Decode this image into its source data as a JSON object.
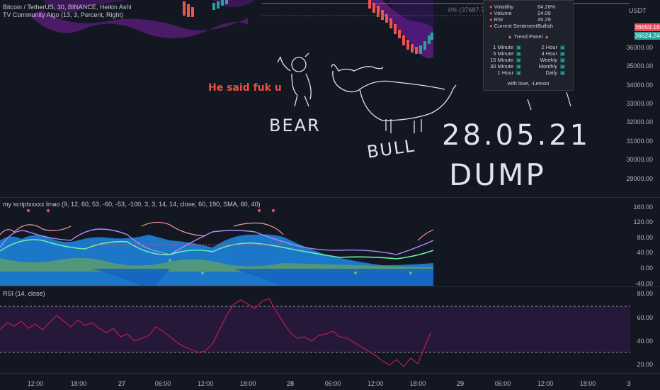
{
  "header": {
    "symbol_line": "Bitcoin / TetherUS, 30, BINANCE, Heikin Ashi",
    "indicator_line": "TV Community Algo (13, 3, Percent, Right)",
    "currency": "USDT"
  },
  "main": {
    "percent_label": "0% (37687.77)",
    "price_axis": [
      "35000.00",
      "34000.00",
      "33000.00",
      "32000.00",
      "31000.00",
      "30000.00",
      "29000.00",
      "36000.00"
    ],
    "price_tags": [
      {
        "text": "36659.16",
        "color": "#e84a5f"
      },
      {
        "text": "36624.24",
        "color": "#26a69a"
      }
    ],
    "annotation_text": "He said fuk u",
    "drawings": {
      "bear_label": "BEAR",
      "bull_label": "BULL",
      "date_label": "28.05.21",
      "dump_label": "DUMP"
    }
  },
  "info_panel": {
    "title": "Market Information",
    "rows": [
      {
        "label": "Volatility",
        "value": "64.28%"
      },
      {
        "label": "Volume",
        "value": "24.09"
      },
      {
        "label": "RSI",
        "value": "45.29"
      },
      {
        "label": "Current Sentiment",
        "value": "Bullish"
      }
    ],
    "trend_title": "Trend Panel",
    "trend_rows": [
      {
        "left": "1 Minute",
        "right": "2 Hour"
      },
      {
        "left": "5 Minute",
        "right": "4 Hour"
      },
      {
        "left": "15 Minute",
        "right": "Weekly"
      },
      {
        "left": "30 Minute",
        "right": "Monthly"
      },
      {
        "left": "1 Hour",
        "right": "Daily"
      }
    ],
    "footer": "with love, -Lemon"
  },
  "osc": {
    "title": "my scriptxxxxx lmao (9, 12, 60, 53, -60, -53, -100, 3, 3, 14, 14, close, 60, 190, SMA, 60, 40)",
    "axis": [
      "160.00",
      "120.00",
      "80.00",
      "40.00",
      "0.00",
      "-40.00"
    ]
  },
  "rsi": {
    "title": "RSI (14, close)",
    "axis": [
      "80.00",
      "60.00",
      "40.00",
      "20.00"
    ]
  },
  "time_axis": [
    {
      "text": "12:00",
      "day": false
    },
    {
      "text": "18:00",
      "day": false
    },
    {
      "text": "27",
      "day": true
    },
    {
      "text": "06:00",
      "day": false
    },
    {
      "text": "12:00",
      "day": false
    },
    {
      "text": "18:00",
      "day": false
    },
    {
      "text": "28",
      "day": true
    },
    {
      "text": "06:00",
      "day": false
    },
    {
      "text": "12:00",
      "day": false
    },
    {
      "text": "18:00",
      "day": false
    },
    {
      "text": "29",
      "day": true
    },
    {
      "text": "06:00",
      "day": false
    },
    {
      "text": "12:00",
      "day": false
    },
    {
      "text": "18:00",
      "day": false
    },
    {
      "text": "3",
      "day": true
    }
  ],
  "colors": {
    "bg": "#131722",
    "up": "#26a69a",
    "down": "#ef5350",
    "band": "#8e24aa",
    "rsi": "#c2185b"
  }
}
